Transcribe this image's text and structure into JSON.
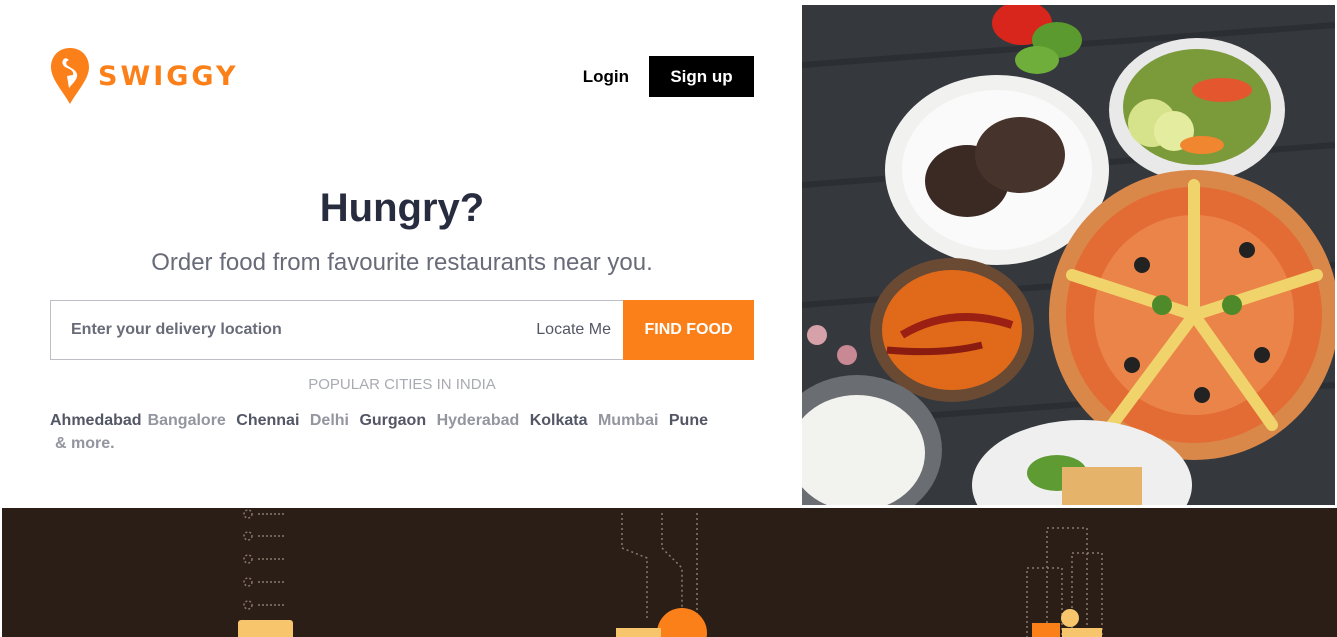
{
  "brand": {
    "name": "SWIGGY",
    "color": "#fc8019"
  },
  "header": {
    "login_label": "Login",
    "signup_label": "Sign up"
  },
  "hero": {
    "title": "Hungry?",
    "subtitle": "Order food from favourite restaurants near you."
  },
  "search": {
    "placeholder": "Enter your delivery location",
    "locate_label": "Locate Me",
    "find_label": "FIND FOOD"
  },
  "popular": {
    "heading": "POPULAR CITIES IN INDIA",
    "cities": [
      "Ahmedabad",
      "Bangalore",
      "Chennai",
      "Delhi",
      "Gurgaon",
      "Hyderabad",
      "Kolkata",
      "Mumbai",
      "Pune"
    ],
    "more_label": "& more."
  },
  "icons": {
    "logo": "swiggy-logo-icon",
    "food_photo": "food-spread-image"
  }
}
